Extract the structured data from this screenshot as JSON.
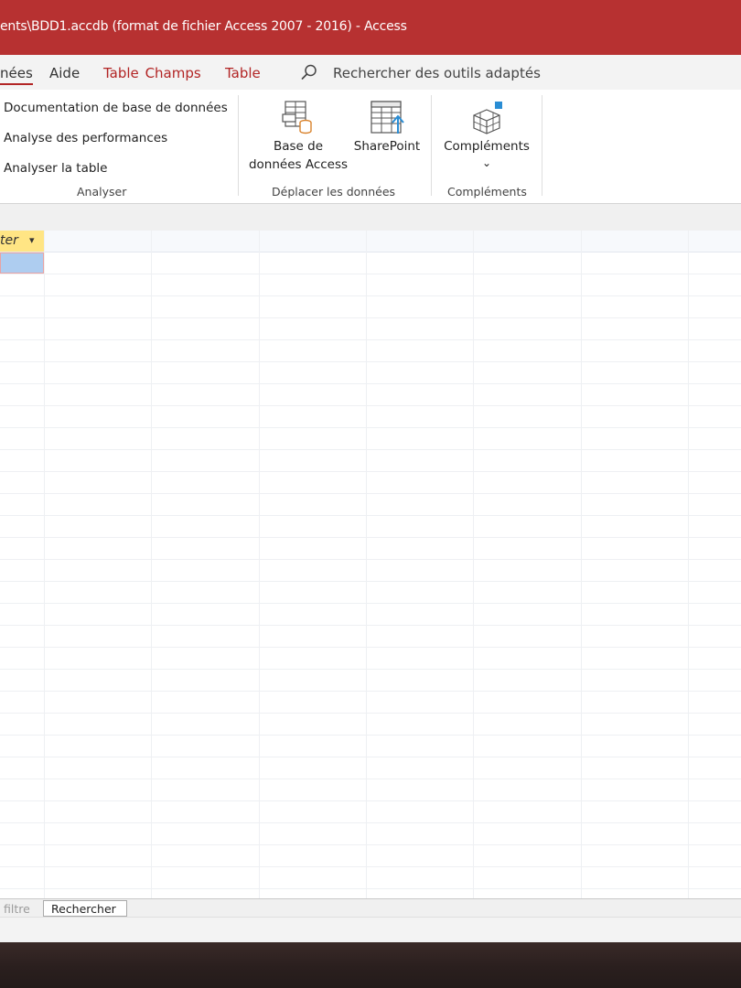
{
  "window": {
    "title": "ents\\BDD1.accdb (format de fichier Access 2007 - 2016)  -  Access"
  },
  "ribbon_tabs": {
    "donnees": "nées",
    "aide": "Aide",
    "table_champs_1": "Table",
    "table_champs_2": "Champs",
    "table": "Table",
    "search_placeholder": "Rechercher des outils adaptés"
  },
  "analyser": {
    "doc": "Documentation de base de données",
    "perf": "Analyse des performances",
    "table": "Analyser la table",
    "group_label": "Analyser"
  },
  "deplacer": {
    "access_line1": "Base de",
    "access_line2": "données Access",
    "sharepoint": "SharePoint",
    "group_label": "Déplacer les données"
  },
  "complements": {
    "button": "Compléments",
    "chevron": "⌄",
    "group_label": "Compléments"
  },
  "datasheet": {
    "header_partial": "ter",
    "dropdown": "▾"
  },
  "nav": {
    "filter_partial": "filtre",
    "search_box": "Rechercher"
  },
  "colors": {
    "title_bar": "#b73131",
    "context_tab": "#b22424",
    "header_highlight": "#ffe584",
    "selected_cell": "#aecdf0"
  }
}
